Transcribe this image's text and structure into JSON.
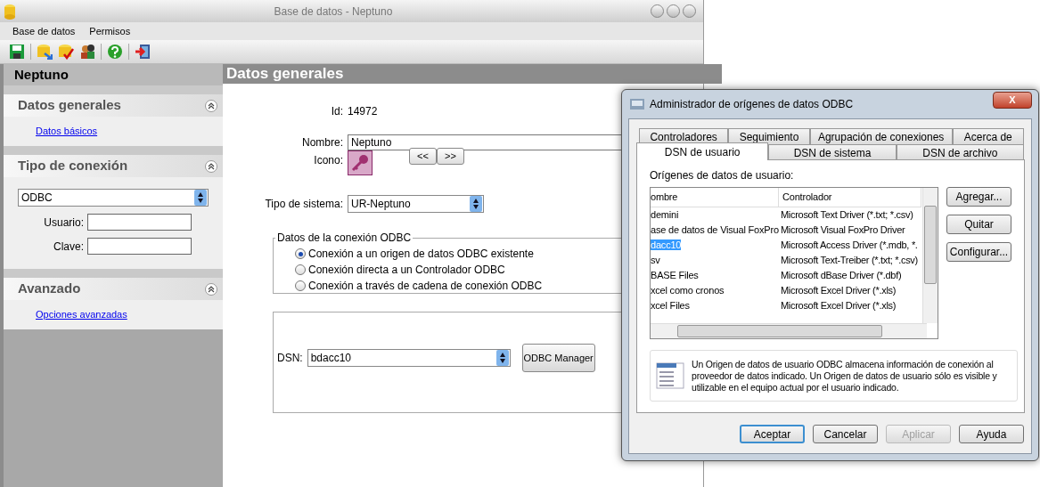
{
  "window": {
    "title": "Base de datos - Neptuno"
  },
  "menu": [
    "Base de datos",
    "Permisos"
  ],
  "toolbar": [
    {
      "kind": "save"
    },
    {
      "kind": "db-arrow"
    },
    {
      "kind": "db-check"
    },
    {
      "kind": "users"
    },
    {
      "kind": "help"
    },
    {
      "kind": "exit"
    }
  ],
  "sidebar": {
    "title": "Neptuno",
    "sections": [
      {
        "title": "Datos generales",
        "links": [
          "Datos básicos"
        ]
      },
      {
        "title": "Tipo de conexión",
        "select": "ODBC",
        "fields": [
          {
            "label": "Usuario:"
          },
          {
            "label": "Clave:"
          }
        ]
      },
      {
        "title": "Avanzado",
        "links": [
          "Opciones avanzadas"
        ]
      }
    ]
  },
  "content": {
    "title": "Datos generales",
    "id_label": "Id:",
    "id_value": "14972",
    "name_label": "Nombre:",
    "name_value": "Neptuno",
    "icon_label": "Icono:",
    "prev": "<<",
    "next": ">>",
    "system_label": "Tipo de sistema:",
    "system_value": "UR-Neptuno",
    "odbc": {
      "legend": "Datos de la conexión ODBC",
      "options": [
        {
          "label": "Conexión a un origen de datos ODBC existente",
          "selected": true
        },
        {
          "label": "Conexión directa a un Controlador ODBC",
          "selected": false
        },
        {
          "label": "Conexión a través de cadena de conexión ODBC",
          "selected": false
        }
      ]
    },
    "dsn_label": "DSN:",
    "dsn_value": "bdacc10",
    "manager_button": "ODBC Manager"
  },
  "dialog": {
    "title": "Administrador de orígenes de datos ODBC",
    "close": "X",
    "tabs_back": [
      {
        "label": "Controladores",
        "selected": false
      },
      {
        "label": "Seguimiento",
        "selected": false
      },
      {
        "label": "Agrupación de conexiones",
        "selected": false
      },
      {
        "label": "Acerca de",
        "selected": false
      }
    ],
    "tabs_front": [
      {
        "label": "DSN de usuario",
        "selected": true
      },
      {
        "label": "DSN de sistema",
        "selected": false
      },
      {
        "label": "DSN de archivo",
        "selected": false
      }
    ],
    "list_label": "Orígenes de datos de usuario:",
    "columns": [
      "ombre",
      "Controlador"
    ],
    "rows": [
      {
        "name": "demini",
        "driver": "Microsoft Text Driver (*.txt; *.csv)",
        "selected": false
      },
      {
        "name": "ase de datos de Visual FoxPro",
        "driver": "Microsoft Visual FoxPro Driver",
        "selected": false
      },
      {
        "name": "dacc10",
        "driver": "Microsoft Access Driver (*.mdb, *.",
        "selected": true
      },
      {
        "name": "sv",
        "driver": "Microsoft Text-Treiber (*.txt; *.csv)",
        "selected": false
      },
      {
        "name": "BASE Files",
        "driver": "Microsoft dBase Driver (*.dbf)",
        "selected": false
      },
      {
        "name": "xcel como cronos",
        "driver": "Microsoft Excel Driver (*.xls)",
        "selected": false
      },
      {
        "name": "xcel Files",
        "driver": "Microsoft Excel Driver (*.xls)",
        "selected": false
      }
    ],
    "side_buttons": [
      "Agregar...",
      "Quitar",
      "Configurar..."
    ],
    "info": "Un Origen de datos de usuario ODBC almacena información de conexión al proveedor de datos indicado. Un Origen de datos de usuario sólo es visible y utilizable en el equipo actual por el usuario indicado.",
    "buttons": [
      {
        "label": "Aceptar",
        "default": true,
        "disabled": false
      },
      {
        "label": "Cancelar",
        "default": false,
        "disabled": false
      },
      {
        "label": "Aplicar",
        "default": false,
        "disabled": true
      },
      {
        "label": "Ayuda",
        "default": false,
        "disabled": false
      }
    ]
  }
}
